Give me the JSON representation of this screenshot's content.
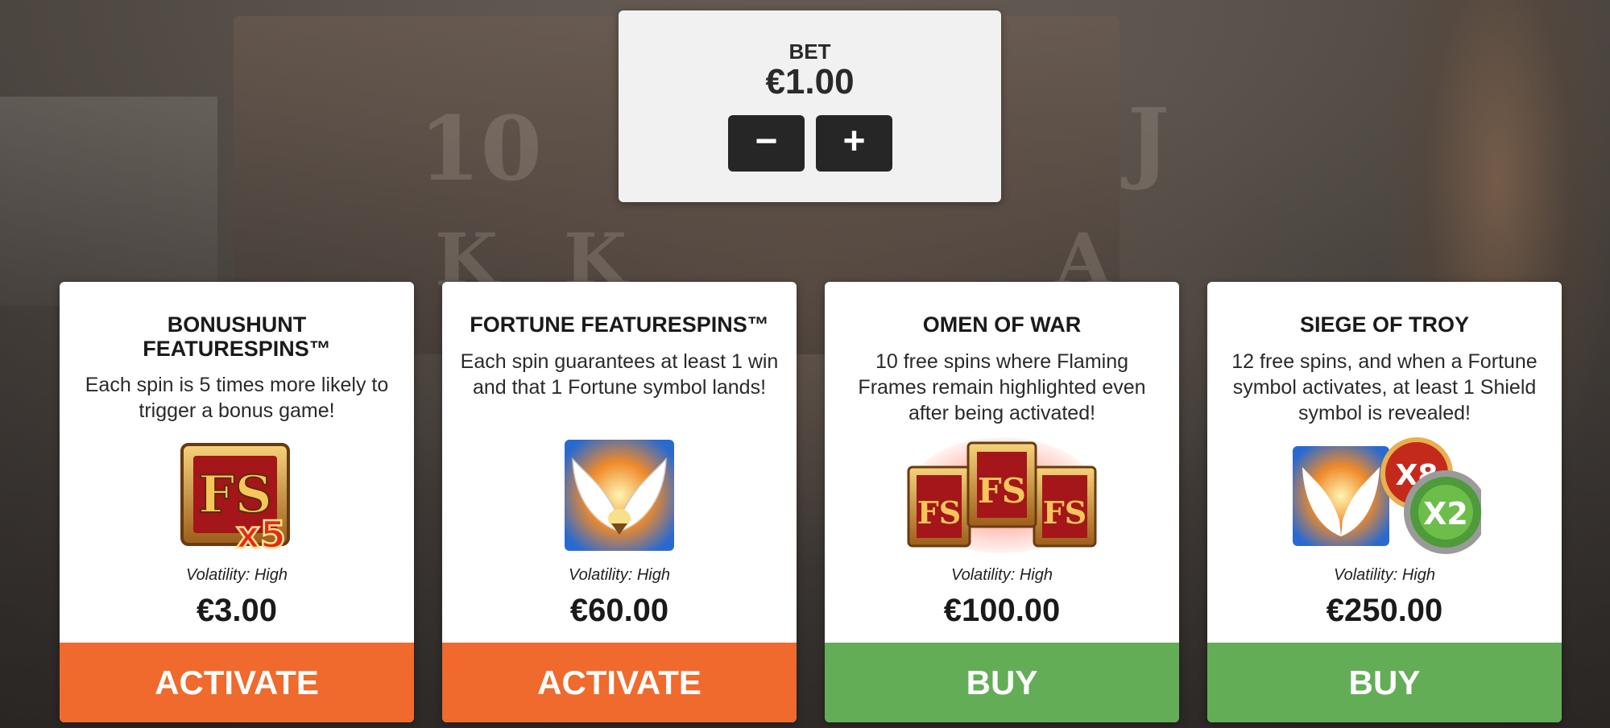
{
  "bet": {
    "label": "BET",
    "value": "€1.00",
    "decrease_label": "−",
    "increase_label": "+"
  },
  "cards": [
    {
      "title": "BONUSHUNT FEATURESPINS™",
      "description": "Each spin is 5 times more likely to trigger a bonus game!",
      "icon": "fs-x5-gold-icon",
      "volatility": "Volatility: High",
      "price": "€3.00",
      "button_label": "ACTIVATE",
      "button_color": "#ef6a2c"
    },
    {
      "title": "FORTUNE FEATURESPINS™",
      "description": "Each spin guarantees at least 1 win and that 1 Fortune symbol lands!",
      "icon": "winged-fortune-icon",
      "volatility": "Volatility: High",
      "price": "€60.00",
      "button_label": "ACTIVATE",
      "button_color": "#ef6a2c"
    },
    {
      "title": "OMEN OF WAR",
      "description": "10 free spins where Flaming Frames remain highlighted even after being activated!",
      "icon": "flaming-fs-frames-icon",
      "volatility": "Volatility: High",
      "price": "€100.00",
      "button_label": "BUY",
      "button_color": "#63ad57"
    },
    {
      "title": "SIEGE OF TROY",
      "description": "12 free spins, and when a Fortune symbol activates, at least 1 Shield symbol is revealed!",
      "icon": "fortune-shield-multiplier-icon",
      "volatility": "Volatility: High",
      "price": "€250.00",
      "button_label": "BUY",
      "button_color": "#63ad57",
      "icon_text": [
        "X8",
        "X2"
      ]
    }
  ]
}
